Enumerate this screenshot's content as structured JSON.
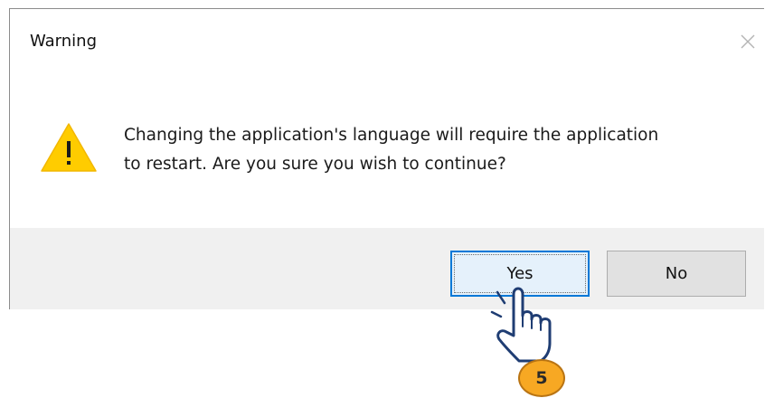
{
  "dialog": {
    "title": "Warning",
    "message_line1": "Changing the application's language will require the application",
    "message_line2": "to restart. Are you sure you wish to continue?",
    "icon": "warning-triangle-icon",
    "buttons": {
      "yes_label": "Yes",
      "no_label": "No"
    },
    "colors": {
      "focus_border": "#0078d7",
      "footer_bg": "#f0f0f0",
      "warning_yellow": "#ffcc00"
    }
  },
  "annotation": {
    "step_number": "5",
    "cursor_icon": "hand-pointer-icon",
    "badge_color": "#f7a823"
  }
}
